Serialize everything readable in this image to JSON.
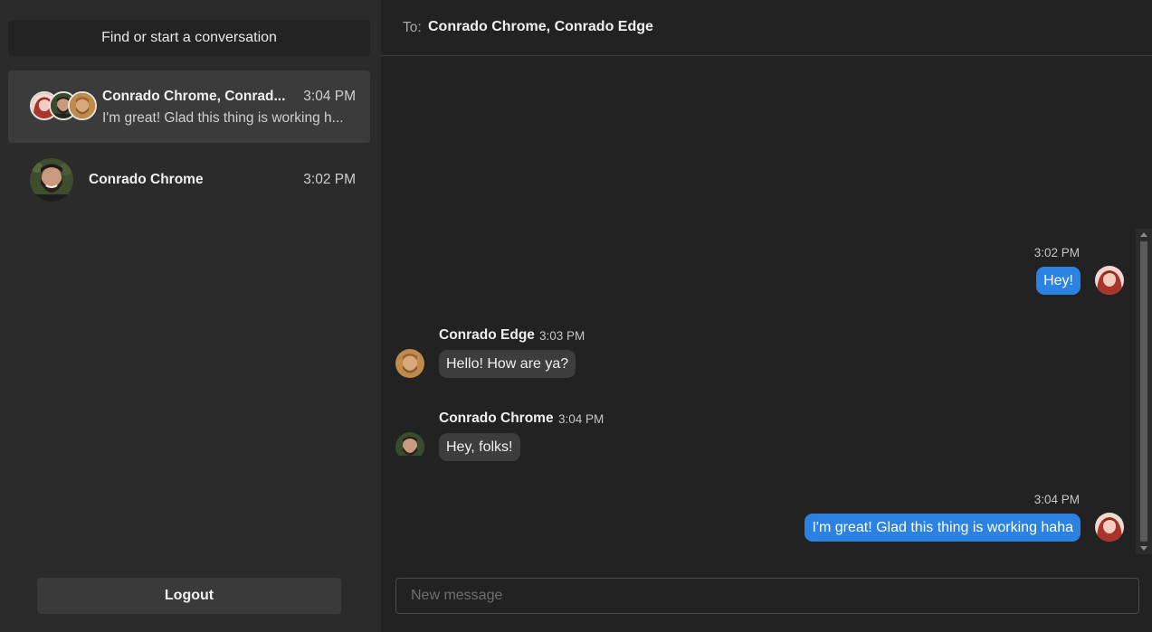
{
  "sidebar": {
    "find_button": "Find or start a conversation",
    "conversations": [
      {
        "name": "Conrado Chrome, Conrad...",
        "time": "3:04 PM",
        "preview": "I'm great! Glad this thing is working h...",
        "avatars": [
          "red-hair-woman-avatar",
          "bearded-man-avatar",
          "blond-man-avatar"
        ]
      },
      {
        "name": "Conrado Chrome",
        "time": "3:02 PM",
        "avatars": [
          "bearded-man-avatar"
        ]
      }
    ],
    "logout_button": "Logout"
  },
  "header": {
    "to_label": "To:",
    "recipients": "Conrado Chrome, Conrado Edge"
  },
  "messages": [
    {
      "sender": "me",
      "time": "3:02 PM",
      "text": "Hey!"
    },
    {
      "sender": "Conrado Edge",
      "time": "3:03 PM",
      "text": "Hello! How are ya?"
    },
    {
      "sender": "Conrado Chrome",
      "time": "3:04 PM",
      "text": "Hey, folks!"
    },
    {
      "sender": "me",
      "time": "3:04 PM",
      "text": "I'm great! Glad this thing is working haha"
    }
  ],
  "composer": {
    "placeholder": "New message",
    "value": ""
  },
  "colors": {
    "sidebar_bg": "#2b2b2b",
    "main_bg": "#222222",
    "my_bubble": "#2b82e0",
    "other_bubble": "#3d3d3d",
    "active_conversation": "#3b3b3b"
  }
}
